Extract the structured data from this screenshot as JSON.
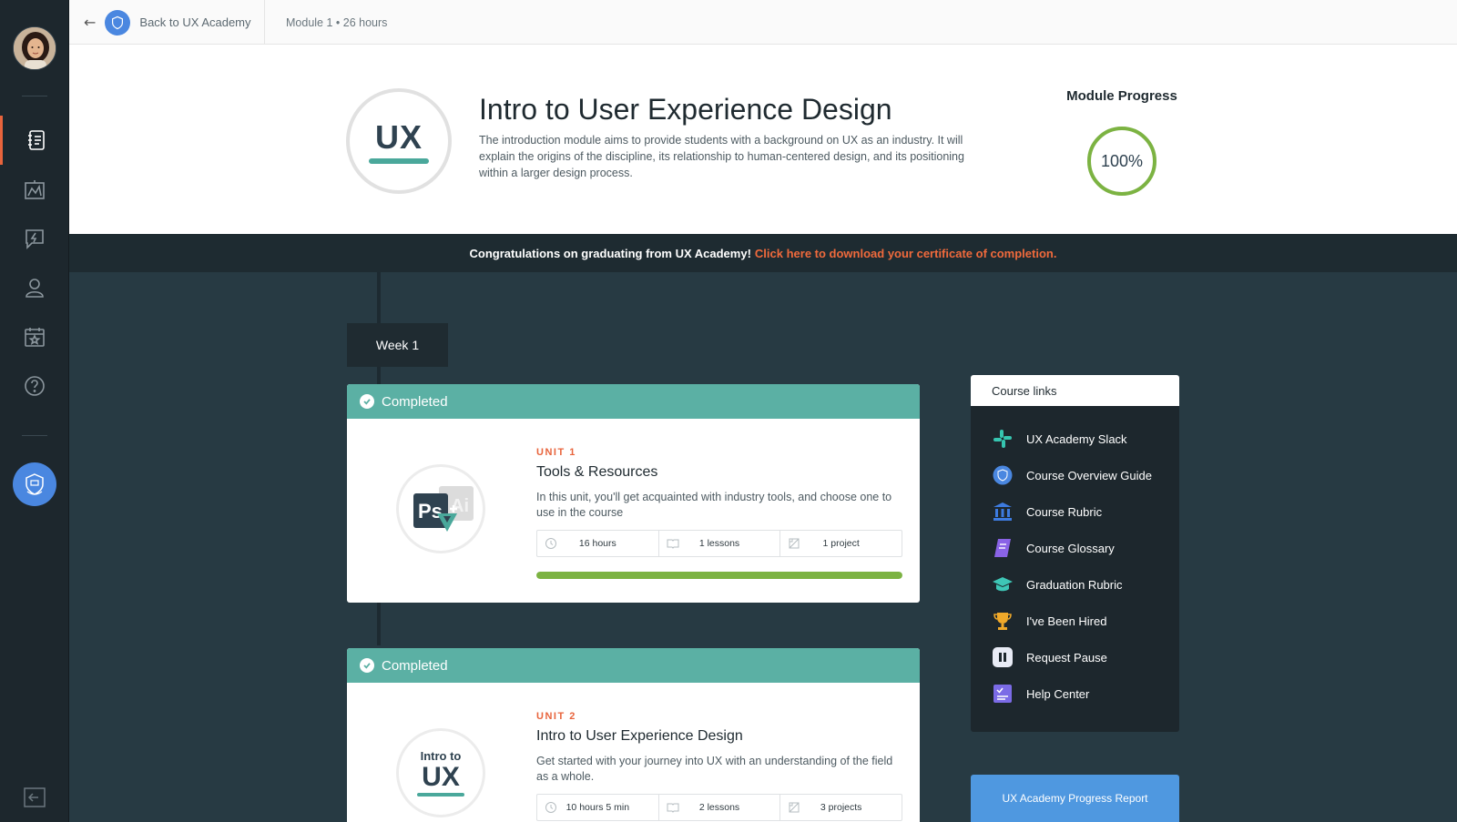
{
  "topbar": {
    "back_label": "Back to UX Academy",
    "module_meta": "Module 1 • 26 hours"
  },
  "header": {
    "logo_text": "UX",
    "title": "Intro to User Experience Design",
    "description": "The introduction module aims to provide students with a background on UX as an industry. It will explain the origins of the discipline, its relationship to human-centered design, and its positioning within a larger design process.",
    "progress_title": "Module Progress",
    "progress_value": "100%",
    "progress_fraction": 1.0
  },
  "banner": {
    "congrats": "Congratulations on graduating from UX Academy!",
    "link": "Click here to download your certificate of completion."
  },
  "week": {
    "label": "Week 1"
  },
  "units": [
    {
      "status": "Completed",
      "num": "UNIT 1",
      "title": "Tools & Resources",
      "description": "In this unit, you'll get acquainted with industry tools, and choose one to use in the course",
      "hours": "16 hours",
      "lessons": "1 lessons",
      "projects": "1 project",
      "progress_fraction": 1.0,
      "image_text_a": "Ps",
      "image_text_b": "Ai"
    },
    {
      "status": "Completed",
      "num": "UNIT 2",
      "title": "Intro to User Experience Design",
      "description": "Get started with your journey into UX with an understanding of the field as a whole.",
      "hours": "10 hours 5 min",
      "lessons": "2 lessons",
      "projects": "3 projects",
      "image_text_a": "Intro to",
      "image_text_b": "UX"
    }
  ],
  "course_links": {
    "title": "Course links",
    "items": [
      {
        "label": "UX Academy Slack",
        "icon": "slack-icon",
        "color": "#36c5b0"
      },
      {
        "label": "Course Overview Guide",
        "icon": "academy-badge-icon",
        "color": "#4a87e0"
      },
      {
        "label": "Course Rubric",
        "icon": "institution-icon",
        "color": "#3d7be0"
      },
      {
        "label": "Course Glossary",
        "icon": "book-icon",
        "color": "#8a63e6"
      },
      {
        "label": "Graduation Rubric",
        "icon": "graduation-cap-icon",
        "color": "#3ec6b6"
      },
      {
        "label": "I've Been Hired",
        "icon": "trophy-icon",
        "color": "#f0a92a"
      },
      {
        "label": "Request Pause",
        "icon": "pause-icon",
        "color": "#e8ebf5"
      },
      {
        "label": "Help Center",
        "icon": "checklist-icon",
        "color": "#7b6be6"
      }
    ]
  },
  "report_button": "UX Academy Progress Report",
  "colors": {
    "accent_orange": "#e8643c",
    "teal": "#5bb0a4",
    "progress_green": "#7cb342",
    "dark_bg": "#273a43",
    "blue": "#4f98e0"
  }
}
